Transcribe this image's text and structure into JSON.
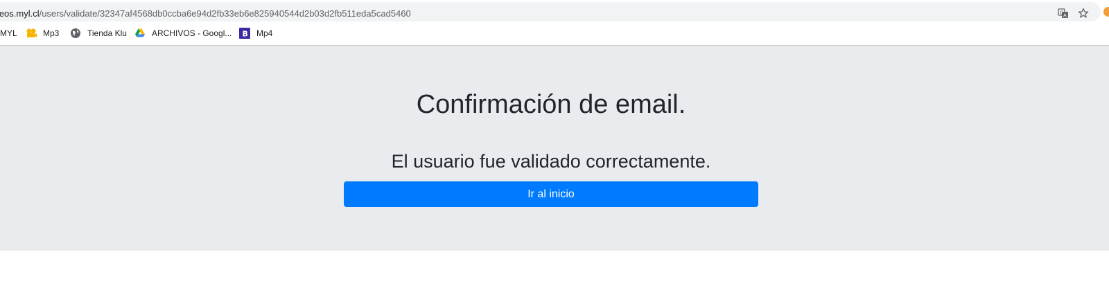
{
  "browser": {
    "url_domain": "orneos.myl.cl",
    "url_path": "/users/validate/32347af4568db0ccba6e94d2fb33eb6e825940544d2b03d2fb511eda5cad5460",
    "translate_icon": "translate-icon",
    "star_icon": "star-icon"
  },
  "bookmarks": {
    "items": [
      {
        "label": "MYL",
        "icon": "none"
      },
      {
        "label": "Mp3",
        "icon": "film-reel-icon"
      },
      {
        "label": "Tienda Klu",
        "icon": "globe-icon"
      },
      {
        "label": "ARCHIVOS - Googl...",
        "icon": "google-drive-icon"
      },
      {
        "label": "Mp4",
        "icon": "letter-b-icon"
      }
    ]
  },
  "page": {
    "title": "Confirmación de email.",
    "message": "El usuario fue validado correctamente.",
    "button_label": "Ir al inicio"
  },
  "colors": {
    "jumbotron_bg": "#e9ecef",
    "button_primary": "#007bff"
  }
}
